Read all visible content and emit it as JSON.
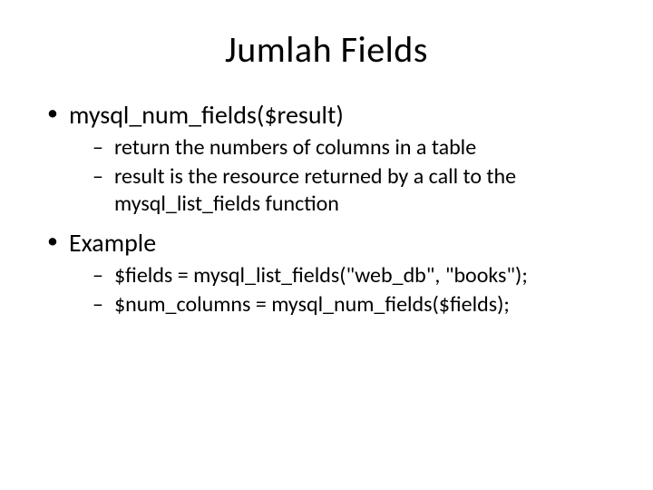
{
  "title": "Jumlah Fields",
  "bullets": [
    {
      "text": "mysql_num_fields($result)",
      "sub": [
        "return the numbers of columns in a table",
        "result is the resource returned by a call to the mysql_list_fields function"
      ]
    },
    {
      "text": "Example",
      "sub": [
        "$fields = mysql_list_fields(\"web_db\", \"books\");",
        "$num_columns = mysql_num_fields($fields);"
      ]
    }
  ]
}
